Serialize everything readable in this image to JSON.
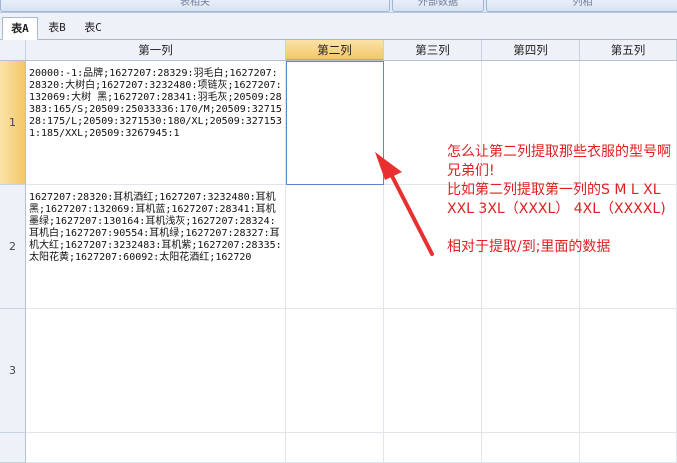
{
  "ribbon": {
    "items": [
      "表相关",
      "外部数据",
      "列相"
    ]
  },
  "tabs": [
    {
      "label": "表A",
      "active": true
    },
    {
      "label": "表B",
      "active": false
    },
    {
      "label": "表C",
      "active": false
    }
  ],
  "grid": {
    "columns": [
      "第一列",
      "第二列",
      "第三列",
      "第四列",
      "第五列"
    ],
    "rows": [
      "1",
      "2",
      "3"
    ],
    "selected_column": "第二列",
    "selected_row": "1",
    "cells": {
      "r1c1": "20000:-1:品牌;1627207:28329:羽毛白;1627207:28320:大树白;1627207:3232480:项链灰;1627207:132069:大树 黑;1627207:28341:羽毛灰;20509:28383:165/S;20509:25033336:170/M;20509:3271528:175/L;20509:3271530:180/XL;20509:3271531:185/XXL;20509:3267945:1",
      "r2c1": "1627207:28320:耳机酒红;1627207:3232480:耳机黑;1627207:132069:耳机蓝;1627207:28341:耳机墨绿;1627207:130164:耳机浅灰;1627207:28324:耳机白;1627207:90554:耳机绿;1627207:28327:耳机大红;1627207:3232483:耳机紫;1627207:28335:太阳花黄;1627207:60092:太阳花酒红;162720"
    }
  },
  "annotation": {
    "text": "怎么让第二列提取那些衣服的型号啊 兄弟们!\n比如第二列提取第一列的S M L XL XXL 3XL（XXXL） 4XL（XXXXL)\n\n相对于提取/到;里面的数据",
    "color": "#e02020"
  },
  "colors": {
    "accent": "#f3c768",
    "selection_border": "#5b86c8"
  }
}
